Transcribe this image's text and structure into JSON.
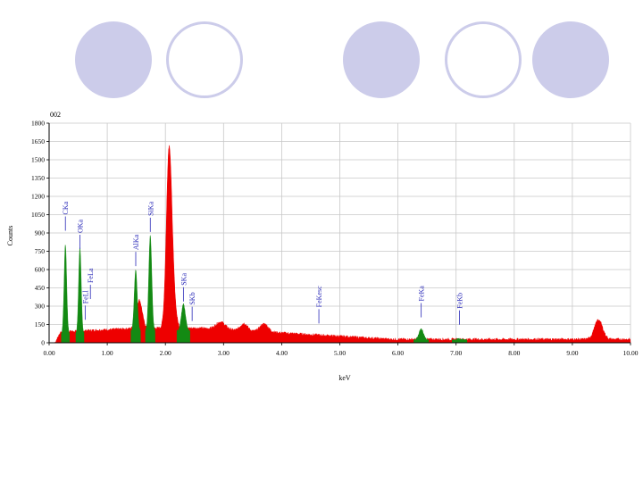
{
  "decor": [
    {
      "kind": "filled"
    },
    {
      "kind": "ring"
    },
    {
      "kind": "filled"
    },
    {
      "kind": "ring"
    },
    {
      "kind": "filled"
    }
  ],
  "colors": {
    "background_spectrum": "#ee0000",
    "peak_fill": "#138a13",
    "peak_label": "#2a2ab8",
    "grid": "#c8c8c8",
    "decor_circle": "#ccccea"
  },
  "chart_data": {
    "type": "area",
    "corner_label": "002",
    "xlabel": "keV",
    "ylabel": "Counts",
    "xlim": [
      0,
      10
    ],
    "ylim": [
      0,
      1800
    ],
    "x_ticks": [
      0,
      1,
      2,
      3,
      4,
      5,
      6,
      7,
      8,
      9,
      10
    ],
    "x_tick_labels": [
      "0.00",
      "1.00",
      "2.00",
      "3.00",
      "4.00",
      "5.00",
      "6.00",
      "7.00",
      "8.00",
      "9.00",
      "10.00"
    ],
    "y_ticks": [
      0,
      150,
      300,
      450,
      600,
      750,
      900,
      1050,
      1200,
      1350,
      1500,
      1650,
      1800
    ],
    "y_tick_labels": [
      "0",
      "150",
      "300",
      "450",
      "600",
      "750",
      "900",
      "1050",
      "1200",
      "1350",
      "1500",
      "1650",
      "1800"
    ],
    "grid": true,
    "background_peaks": [
      {
        "center": 2.06,
        "height": 1330,
        "width": 0.045
      },
      {
        "center": 2.12,
        "height": 320,
        "width": 0.05
      },
      {
        "center": 1.55,
        "height": 230,
        "width": 0.05
      },
      {
        "center": 2.95,
        "height": 60,
        "width": 0.08
      },
      {
        "center": 3.35,
        "height": 60,
        "width": 0.06
      },
      {
        "center": 3.7,
        "height": 65,
        "width": 0.07
      },
      {
        "center": 9.45,
        "height": 160,
        "width": 0.07
      }
    ],
    "element_peaks": [
      {
        "label": "CKa",
        "center": 0.28,
        "height": 730,
        "width": 0.022,
        "label_y": 1050
      },
      {
        "label": "OKa",
        "center": 0.53,
        "height": 700,
        "width": 0.022,
        "label_y": 900
      },
      {
        "label": "AlKa",
        "center": 1.49,
        "height": 500,
        "width": 0.026,
        "label_y": 780
      },
      {
        "label": "SiKa",
        "center": 1.74,
        "height": 780,
        "width": 0.026,
        "label_y": 1050
      },
      {
        "label": "SKa",
        "center": 2.31,
        "height": 220,
        "width": 0.035,
        "label_y": 470
      },
      {
        "label": "FeKb",
        "center": 7.06,
        "height": 10,
        "width": 0.04,
        "label_y": 280
      },
      {
        "label": "FeKa",
        "center": 6.4,
        "height": 90,
        "width": 0.04,
        "label_y": 330
      }
    ],
    "peak_labels": [
      {
        "text": "CKa",
        "x": 0.28,
        "y": 1050
      },
      {
        "text": "OKa",
        "x": 0.53,
        "y": 900
      },
      {
        "text": "FeLl",
        "x": 0.62,
        "y": 320
      },
      {
        "text": "FeLa",
        "x": 0.71,
        "y": 490
      },
      {
        "text": "AlKa",
        "x": 1.49,
        "y": 760
      },
      {
        "text": "SiKa",
        "x": 1.74,
        "y": 1040
      },
      {
        "text": "SKa",
        "x": 2.31,
        "y": 470
      },
      {
        "text": "SKb",
        "x": 2.46,
        "y": 310
      },
      {
        "text": "FeKesc",
        "x": 4.64,
        "y": 290
      },
      {
        "text": "FeKa",
        "x": 6.4,
        "y": 340
      },
      {
        "text": "FeKb",
        "x": 7.06,
        "y": 280
      }
    ]
  }
}
